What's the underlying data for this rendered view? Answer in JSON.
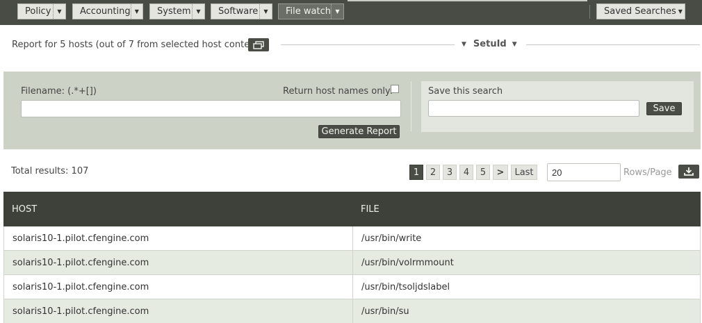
{
  "nav": {
    "items": [
      {
        "label": "Policy"
      },
      {
        "label": "Accounting"
      },
      {
        "label": "System"
      },
      {
        "label": "Software"
      },
      {
        "label": "File watch"
      }
    ],
    "saved_searches": "Saved Searches"
  },
  "report": {
    "title": "Report for 5 hosts (out of 7 from selected host context)",
    "section": "SetuId"
  },
  "filter": {
    "filename_label": "Filename: (.*+[])",
    "filename_value": "",
    "hostnames_label": "Return host names only:",
    "hostnames_checked": false,
    "generate_label": "Generate Report",
    "save_label": "Save this search",
    "save_value": "",
    "save_button": "Save"
  },
  "results": {
    "total": "Total results: 107",
    "pages": [
      "1",
      "2",
      "3",
      "4",
      "5"
    ],
    "current_page": "1",
    "next": ">",
    "last": "Last",
    "rows_value": "20",
    "rows_label": "Rows/Page"
  },
  "table": {
    "headers": [
      "HOST",
      "FILE"
    ],
    "rows": [
      [
        "solaris10-1.pilot.cfengine.com",
        "/usr/bin/write"
      ],
      [
        "solaris10-1.pilot.cfengine.com",
        "/usr/bin/volrmmount"
      ],
      [
        "solaris10-1.pilot.cfengine.com",
        "/usr/bin/tsoljdslabel"
      ],
      [
        "solaris10-1.pilot.cfengine.com",
        "/usr/bin/su"
      ]
    ]
  },
  "colors": {
    "nav_bg": "#494c44",
    "panel_bg": "#ccd2c6",
    "table_header_bg": "#3e413a",
    "row_alt_bg": "#e6ebe1",
    "button_dark": "#4a4d45"
  }
}
